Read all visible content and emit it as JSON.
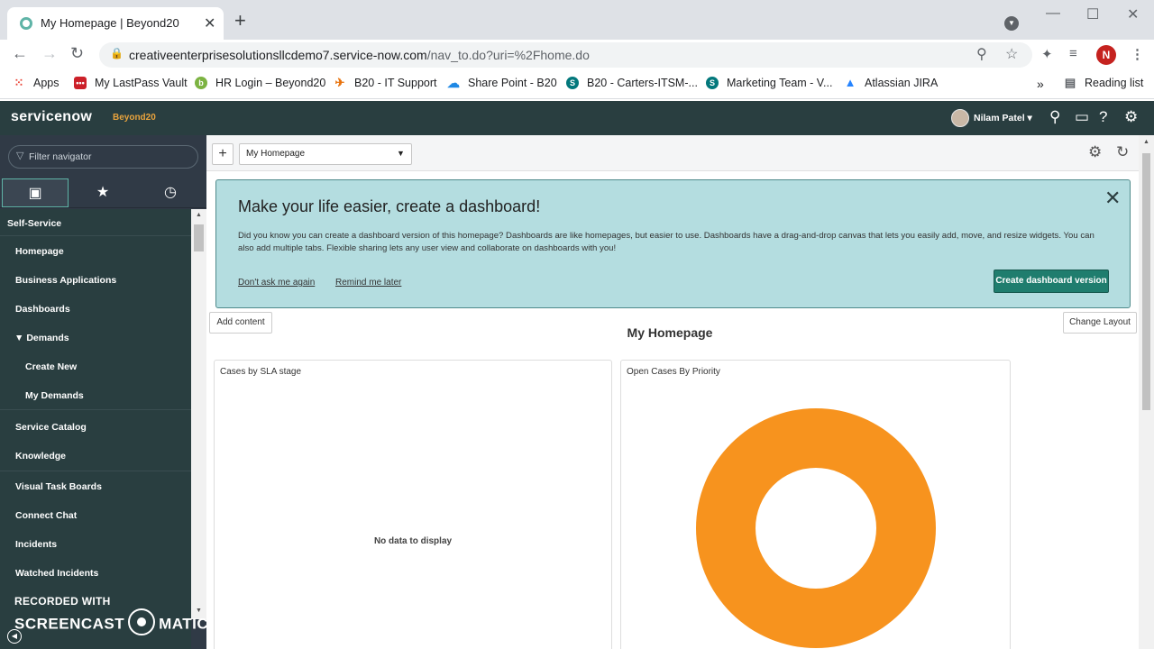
{
  "browser": {
    "tab_title": "My Homepage | Beyond20",
    "url_host": "creativeenterprisesolutionsllcdemo7.service-now.com",
    "url_path": "/nav_to.do?uri=%2Fhome.do",
    "profile_initial": "N",
    "bookmarks": [
      {
        "label": "Apps",
        "icon": "apps-grid-icon",
        "color": "#ea4335"
      },
      {
        "label": "My LastPass Vault",
        "icon": "lastpass-icon",
        "color": "#cc2029"
      },
      {
        "label": "HR Login – Beyond20",
        "icon": "hr-login-icon",
        "color": "#7cb342"
      },
      {
        "label": "B20 - IT Support",
        "icon": "it-support-icon",
        "color": "#e8710a"
      },
      {
        "label": "Share Point - B20",
        "icon": "cloud-icon",
        "color": "#1e88e5"
      },
      {
        "label": "B20 - Carters-ITSM-...",
        "icon": "sharepoint-icon",
        "color": "#03787c"
      },
      {
        "label": "Marketing Team - V...",
        "icon": "sharepoint-icon",
        "color": "#03787c"
      },
      {
        "label": "Atlassian JIRA",
        "icon": "jira-icon",
        "color": "#2684ff"
      }
    ],
    "reading_list": "Reading list"
  },
  "header": {
    "logo": "servicenow",
    "instance": "Beyond20",
    "user": "Nilam Patel"
  },
  "sidebar": {
    "filter_placeholder": "Filter navigator",
    "section": "Self-Service",
    "items": [
      "Homepage",
      "Business Applications",
      "Dashboards",
      "Demands",
      "Create New",
      "My Demands",
      "Service Catalog",
      "Knowledge",
      "Visual Task Boards",
      "Connect Chat",
      "Incidents",
      "Watched Incidents"
    ],
    "watermark_top": "RECORDED WITH",
    "watermark_left": "SCREENCAST",
    "watermark_right": "MATIC"
  },
  "main": {
    "homepage_select": "My Homepage",
    "banner": {
      "title": "Make your life easier, create a dashboard!",
      "description": "Did you know you can create a dashboard version of this homepage? Dashboards are like homepages, but easier to use. Dashboards have a drag-and-drop canvas that lets you easily add, move, and resize widgets. You can also add multiple tabs. Flexible sharing lets any user view and collaborate on dashboards with you!",
      "dont_ask": "Don't ask me again",
      "remind": "Remind me later",
      "create_button": "Create dashboard version"
    },
    "add_content": "Add content",
    "change_layout": "Change Layout",
    "page_title": "My Homepage",
    "widget_sla": {
      "title": "Cases by SLA stage",
      "empty": "No data to display"
    },
    "widget_priority": {
      "title": "Open Cases By Priority"
    }
  },
  "chart_data": {
    "type": "pie",
    "title": "Open Cases By Priority",
    "slices": [
      {
        "value": 1,
        "color": "#f7931e"
      }
    ]
  }
}
